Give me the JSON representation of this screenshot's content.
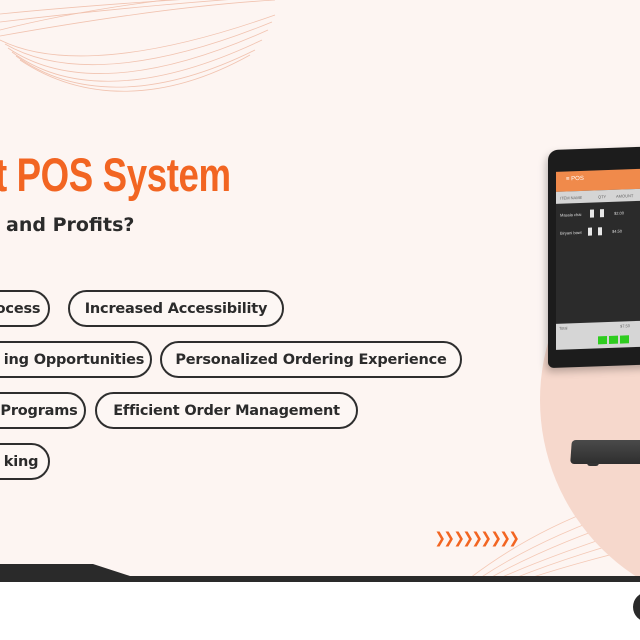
{
  "banner": {
    "title_visible": "t POS System",
    "subtitle_visible": "and Profits?",
    "accent_color": "#f26522",
    "text_color": "#2b2b2b",
    "background_color": "#fdf5f2"
  },
  "features": [
    {
      "label": "ocess"
    },
    {
      "label": "Increased Accessibility"
    },
    {
      "label": "ing Opportunities"
    },
    {
      "label": "Personalized Ordering Experience"
    },
    {
      "label": "Programs"
    },
    {
      "label": "Efficient Order Management"
    },
    {
      "label": "king"
    }
  ],
  "decor": {
    "arrows": "❯❯❯❯❯❯❯❯❯",
    "arrow_color": "#f26522"
  },
  "pos_screen": {
    "header_label": "≡ POS",
    "columns": [
      "ITEM NAME",
      "QTY",
      "AMOUNT"
    ],
    "rows": [
      {
        "name": "Masala chai",
        "amount": "$2.00"
      },
      {
        "name": "Biryani bowl",
        "amount": "$4.50"
      }
    ],
    "total_label": "Total",
    "total_value": "$7.50",
    "action_button_color": "#2ecc1f"
  }
}
